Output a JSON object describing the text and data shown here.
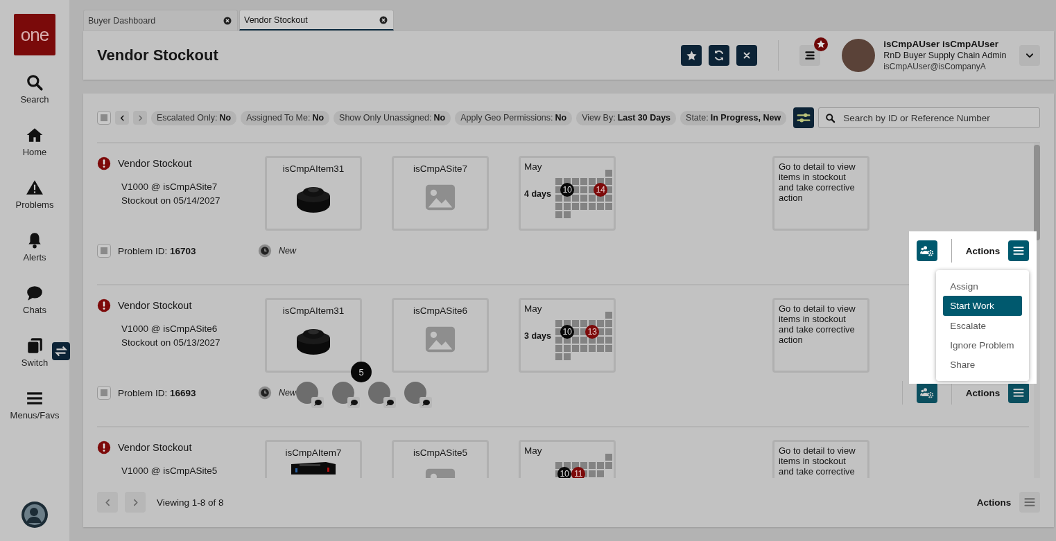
{
  "app": {
    "logo": "one"
  },
  "sidebar": {
    "items": [
      {
        "label": "Search",
        "kind": "search"
      },
      {
        "label": "Home",
        "kind": "home"
      },
      {
        "label": "Problems",
        "kind": "warning"
      },
      {
        "label": "Alerts",
        "kind": "bell"
      },
      {
        "label": "Chats",
        "kind": "chat"
      },
      {
        "label": "Switch",
        "kind": "switch",
        "badge": true
      },
      {
        "label": "Menus/Favs",
        "kind": "menu"
      }
    ]
  },
  "tabs": [
    {
      "label": "Buyer Dashboard",
      "selected": false
    },
    {
      "label": "Vendor Stockout",
      "selected": true
    }
  ],
  "header": {
    "title": "Vendor Stockout",
    "notification": true,
    "user": {
      "name": "isCmpAUser isCmpAUser",
      "role": "RnD Buyer Supply Chain Admin",
      "email": "isCmpAUser@isCompanyA"
    }
  },
  "filters": {
    "checked": false,
    "chips": [
      {
        "label": "Escalated Only:",
        "value": "No"
      },
      {
        "label": "Assigned To Me:",
        "value": "No"
      },
      {
        "label": "Show Only Unassigned:",
        "value": "No"
      },
      {
        "label": "Apply Geo Permissions:",
        "value": "No"
      },
      {
        "label": "View By:",
        "value": "Last 30 Days"
      },
      {
        "label": "State:",
        "value": "In Progress, New"
      }
    ],
    "search": {
      "placeholder": "Search by ID or Reference Number"
    }
  },
  "problems": [
    {
      "type": "Vendor Stockout",
      "line1": "V1000 @ isCmpASite7",
      "line2": "Stockout on 05/14/2027",
      "item": {
        "name": "isCmpAItem31",
        "kind": "picture"
      },
      "site": {
        "name": "isCmpASite7",
        "kind": "placeholder"
      },
      "calendar": {
        "month": "May",
        "duration": "4 days",
        "start": "10",
        "end": "14"
      },
      "note": "Go to detail to view items in stockout and take corrective action",
      "checked": false,
      "id_label": "Problem ID:",
      "id": "16703",
      "status": "New",
      "actions_label": "Actions",
      "menu_open": true,
      "menu": [
        {
          "label": "Assign",
          "selected": false
        },
        {
          "label": "Start Work",
          "selected": true
        },
        {
          "label": "Escalate",
          "selected": false
        },
        {
          "label": "Ignore Problem",
          "selected": false
        },
        {
          "label": "Share",
          "selected": false
        }
      ]
    },
    {
      "type": "Vendor Stockout",
      "line1": "V1000 @ isCmpASite6",
      "line2": "Stockout on 05/13/2027",
      "item": {
        "name": "isCmpAItem31",
        "kind": "picture",
        "count": "5"
      },
      "site": {
        "name": "isCmpASite6",
        "kind": "placeholder"
      },
      "calendar": {
        "month": "May",
        "duration": "3 days",
        "start": "10",
        "end": "13"
      },
      "note": "Go to detail to view items in stockout and take corrective action",
      "checked": false,
      "id_label": "Problem ID:",
      "id": "16693",
      "status": "New",
      "participants": [
        {
          "kind": "avatar"
        },
        {
          "kind": "avatar"
        },
        {
          "kind": "avatar"
        },
        {
          "kind": "avatar"
        }
      ],
      "actions_label": "Actions",
      "menu_open": false
    },
    {
      "type": "Vendor Stockout",
      "line1": "V1000 @ isCmpASite5",
      "item": {
        "name": "isCmpAItem7",
        "kind": "picture"
      },
      "site": {
        "name": "isCmpASite5",
        "kind": "placeholder"
      },
      "calendar": {
        "month": "May",
        "start": "10",
        "end": "11"
      },
      "note": "Go to detail to view items in stockout and take corrective"
    }
  ],
  "footer": {
    "viewing": "Viewing 1-8 of 8",
    "actions_label": "Actions"
  }
}
